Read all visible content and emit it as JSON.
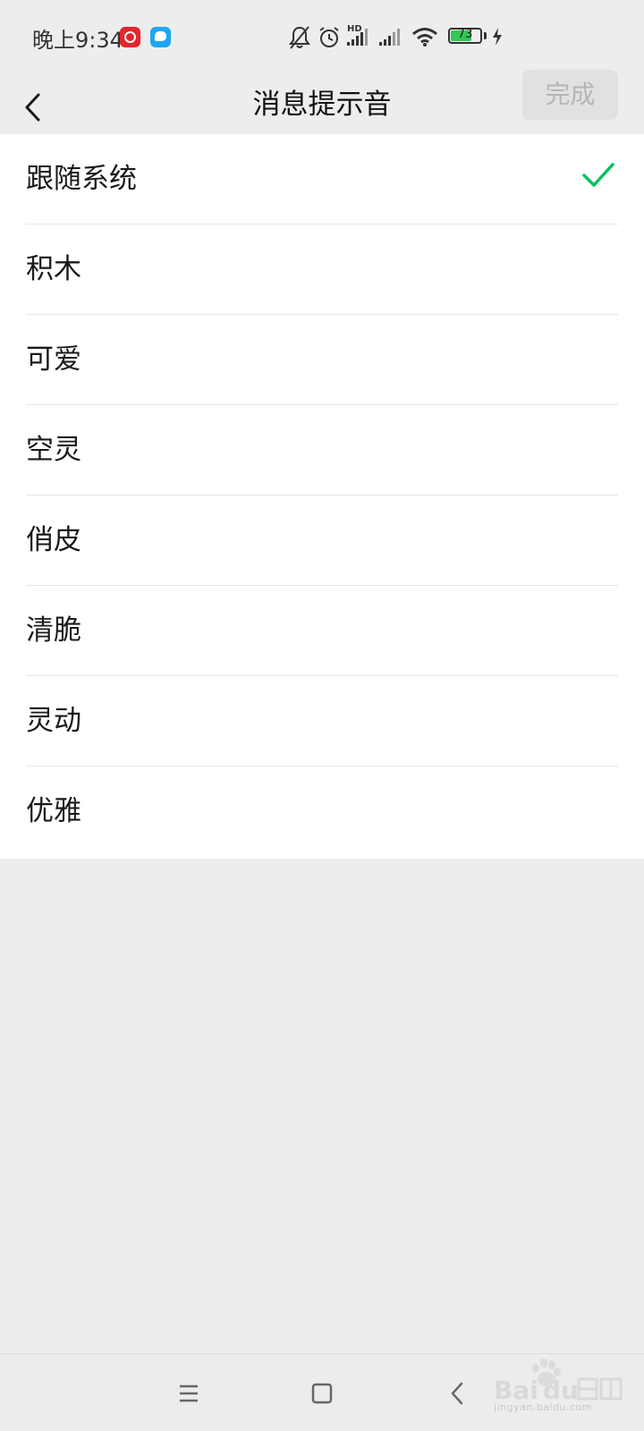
{
  "status_bar": {
    "time": "晚上9:34",
    "network_badge": "HD",
    "battery_level": "73",
    "battery_fraction": 0.73,
    "icons": [
      "netease-music-icon",
      "message-app-icon",
      "mute-bell-icon",
      "alarm-icon",
      "signal-icon",
      "signal-icon",
      "wifi-icon",
      "battery-icon",
      "charging-bolt-icon"
    ]
  },
  "header": {
    "title": "消息提示音",
    "done_label": "完成",
    "back_icon": "chevron-left-icon"
  },
  "sound_list": {
    "selected_index": 0,
    "items": [
      {
        "label": "跟随系统"
      },
      {
        "label": "积木"
      },
      {
        "label": "可爱"
      },
      {
        "label": "空灵"
      },
      {
        "label": "俏皮"
      },
      {
        "label": "清脆"
      },
      {
        "label": "灵动"
      },
      {
        "label": "优雅"
      }
    ]
  },
  "colors": {
    "accent_check": "#07c160",
    "background": "#ededed",
    "list_background": "#ffffff",
    "done_button_bg": "#e1e1e1",
    "done_button_text": "#b6b6b6"
  },
  "nav_bar": {
    "icons": [
      "menu-icon",
      "home-square-icon",
      "back-chevron-icon"
    ]
  },
  "watermark": {
    "text": "jingyan.baidu.com"
  }
}
